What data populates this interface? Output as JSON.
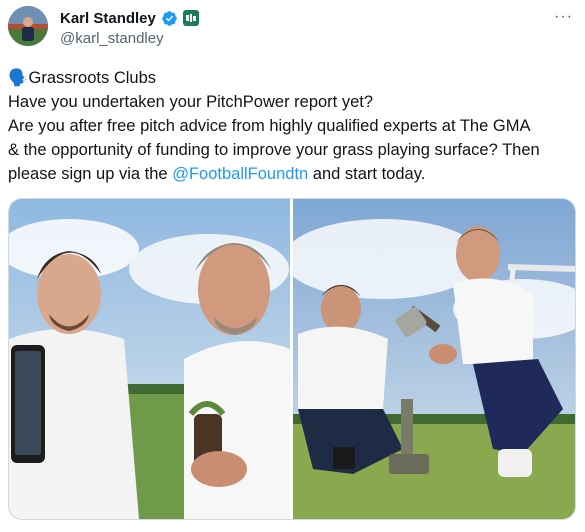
{
  "author": {
    "display_name": "Karl Standley",
    "handle": "@karl_standley",
    "avatar_icon": "profile-photo",
    "verified_icon": "verified-badge-icon",
    "affiliation_icon": "affiliation-badge-icon"
  },
  "menu": {
    "more_label": "···"
  },
  "tweet": {
    "line1_emoji": "🗣️",
    "line1_text": "Grassroots Clubs",
    "line2": "Have you undertaken your PitchPower report yet?",
    "line3": "Are you after free pitch advice from highly qualified experts at The GMA",
    "line4": "& the opportunity of funding to improve your grass playing surface? Then",
    "line5_before": "please sign up via the ",
    "line5_mention": "@FootballFoundtn",
    "line5_after": " and start today."
  },
  "media": {
    "photos": [
      {
        "label": "photo-two-men-holding-phone-and-turf-plug"
      },
      {
        "label": "photo-men-kneeling-testing-pitch"
      }
    ]
  },
  "colors": {
    "link": "#1d9bf0",
    "verified": "#1d9bf0",
    "text": "#0f1419",
    "muted": "#536471"
  }
}
